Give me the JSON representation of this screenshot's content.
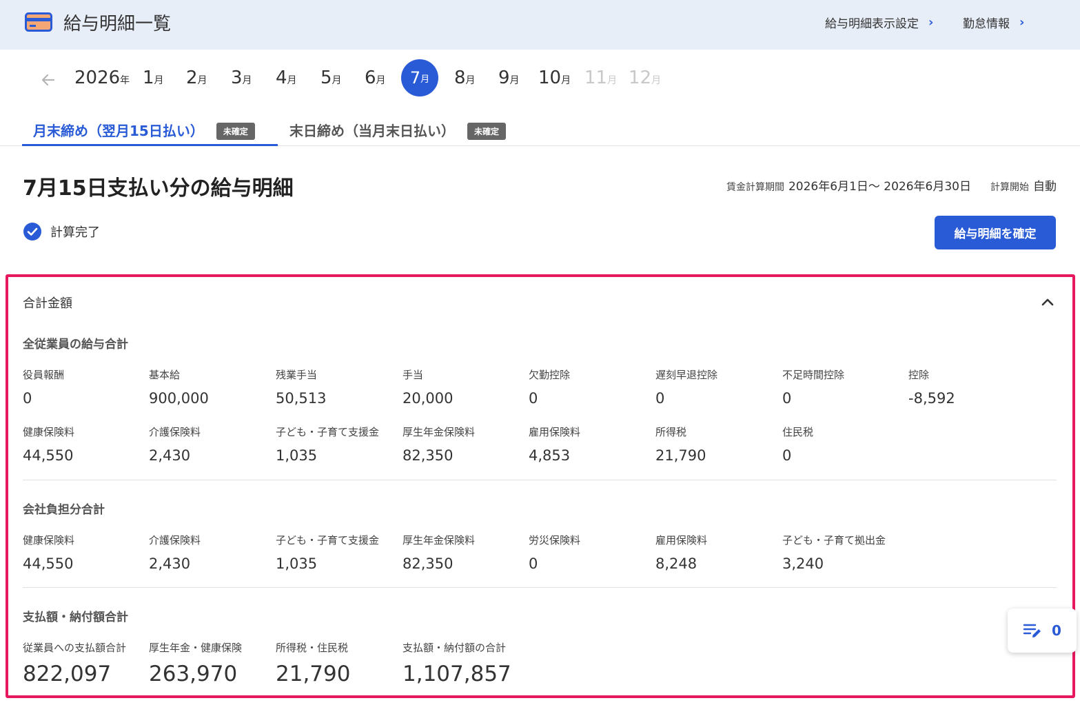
{
  "header": {
    "title": "給与明細一覧",
    "links": [
      "給与明細表示設定",
      "勤怠情報"
    ]
  },
  "months": {
    "year": "2026",
    "year_suffix": "年",
    "month_suffix": "月",
    "items": [
      "1",
      "2",
      "3",
      "4",
      "5",
      "6",
      "7",
      "8",
      "9",
      "10",
      "11",
      "12"
    ],
    "selected": "7",
    "disabled": [
      "11",
      "12"
    ]
  },
  "tabs": [
    {
      "label": "月末締め（翌月15日払い）",
      "badge": "未確定",
      "active": true
    },
    {
      "label": "末日締め（当月末日払い）",
      "badge": "未確定",
      "active": false
    }
  ],
  "page": {
    "title": "7月15日支払い分の給与明細",
    "period_label": "賃金計算期間",
    "period_value": "2026年6月1日〜 2026年6月30日",
    "start_label": "計算開始",
    "start_value": "自動",
    "status": "計算完了",
    "confirm_button": "給与明細を確定"
  },
  "summary": {
    "title": "合計金額",
    "employee": {
      "title": "全従業員の給与合計",
      "row1": [
        {
          "label": "役員報酬",
          "value": "0"
        },
        {
          "label": "基本給",
          "value": "900,000"
        },
        {
          "label": "残業手当",
          "value": "50,513"
        },
        {
          "label": "手当",
          "value": "20,000"
        },
        {
          "label": "欠勤控除",
          "value": "0"
        },
        {
          "label": "遅刻早退控除",
          "value": "0"
        },
        {
          "label": "不足時間控除",
          "value": "0"
        },
        {
          "label": "控除",
          "value": "-8,592"
        }
      ],
      "row2": [
        {
          "label": "健康保険料",
          "value": "44,550"
        },
        {
          "label": "介護保険料",
          "value": "2,430"
        },
        {
          "label": "子ども・子育て支援金",
          "value": "1,035"
        },
        {
          "label": "厚生年金保険料",
          "value": "82,350"
        },
        {
          "label": "雇用保険料",
          "value": "4,853"
        },
        {
          "label": "所得税",
          "value": "21,790"
        },
        {
          "label": "住民税",
          "value": "0"
        }
      ]
    },
    "company": {
      "title": "会社負担分合計",
      "row": [
        {
          "label": "健康保険料",
          "value": "44,550"
        },
        {
          "label": "介護保険料",
          "value": "2,430"
        },
        {
          "label": "子ども・子育て支援金",
          "value": "1,035"
        },
        {
          "label": "厚生年金保険料",
          "value": "82,350"
        },
        {
          "label": "労災保険料",
          "value": "0"
        },
        {
          "label": "雇用保険料",
          "value": "8,248"
        },
        {
          "label": "子ども・子育て拠出金",
          "value": "3,240"
        }
      ]
    },
    "payments": {
      "title": "支払額・納付額合計",
      "row": [
        {
          "label": "従業員への支払額合計",
          "value": "822,097"
        },
        {
          "label": "厚生年金・健康保険",
          "value": "263,970"
        },
        {
          "label": "所得税・住民税",
          "value": "21,790"
        },
        {
          "label": "支払額・納付額の合計",
          "value": "1,107,857"
        }
      ]
    }
  },
  "memo": {
    "count": "0"
  },
  "colors": {
    "accent": "#2a5bd7",
    "highlight": "#e8185f"
  }
}
